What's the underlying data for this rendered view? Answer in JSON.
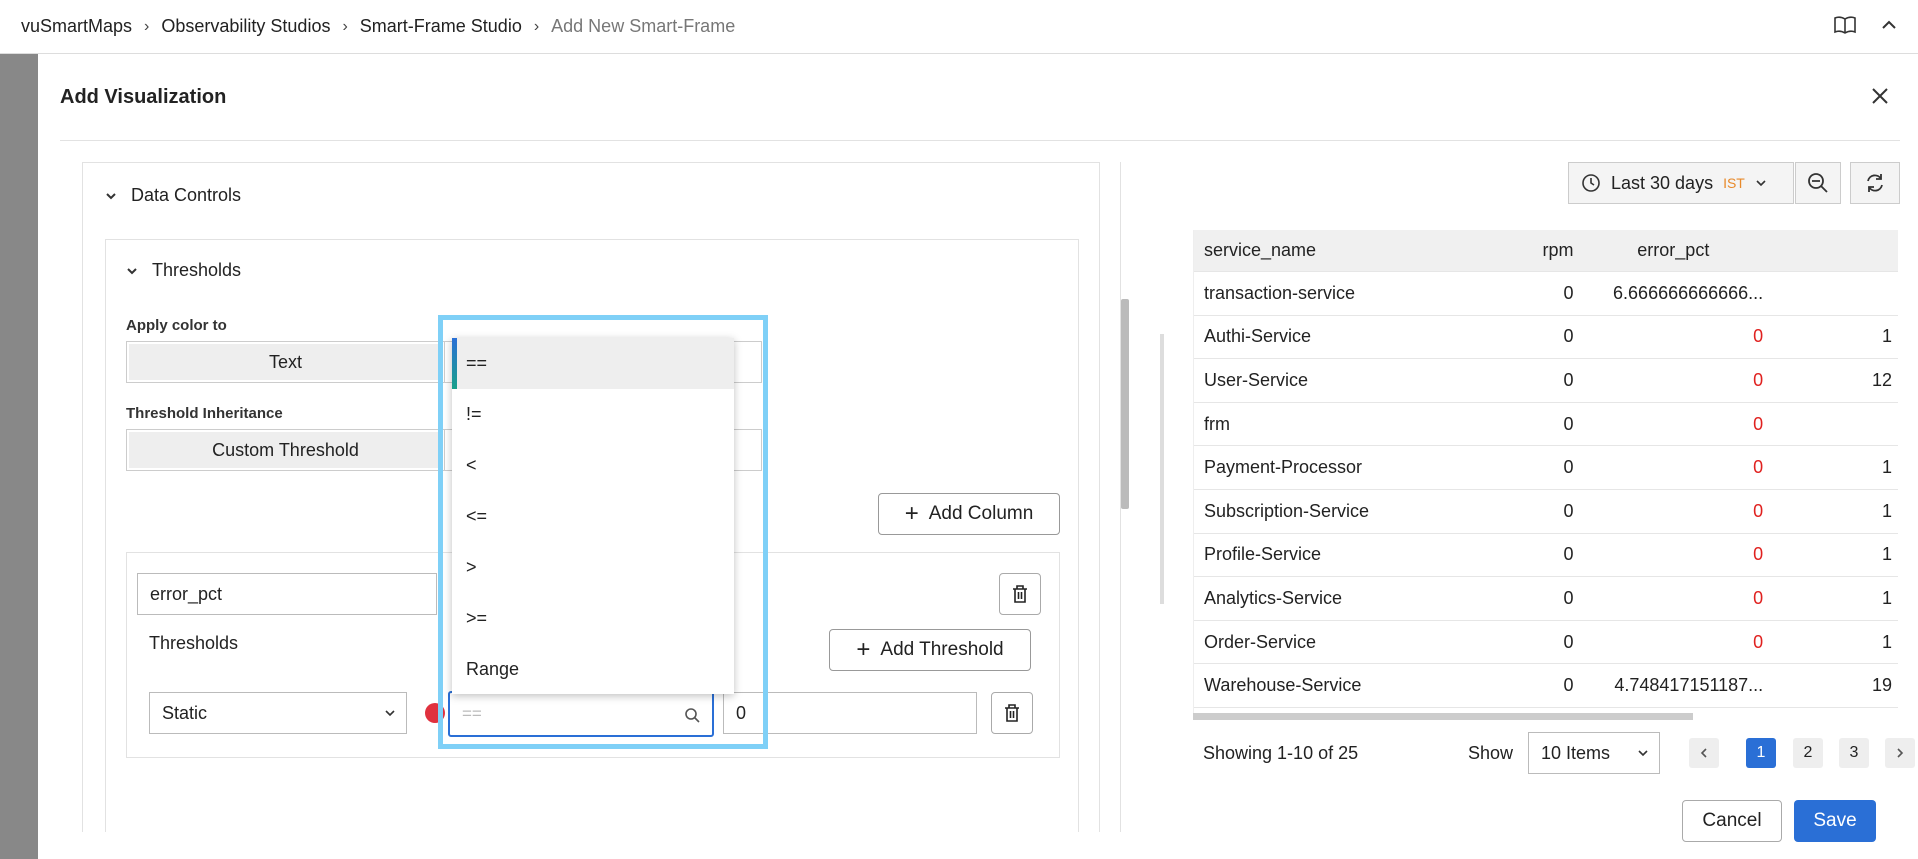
{
  "breadcrumb": [
    "vuSmartMaps",
    "Observability Studios",
    "Smart-Frame Studio",
    "Add New Smart-Frame"
  ],
  "modal": {
    "title": "Add Visualization",
    "data_controls": "Data Controls",
    "thresholds": "Thresholds",
    "apply_color_to_label": "Apply color to",
    "apply_color_selected": "Text",
    "threshold_inheritance_label": "Threshold Inheritance",
    "threshold_inheritance_selected": "Custom Threshold",
    "add_column": "Add Column",
    "column_value": "error_pct",
    "thresholds_sub": "Thresholds",
    "add_threshold": "Add Threshold",
    "threshold_type": "Static",
    "operator_placeholder": "==",
    "threshold_value": "0",
    "cancel": "Cancel",
    "save": "Save"
  },
  "operator_options": [
    "==",
    "!=",
    "<",
    "<=",
    ">",
    ">=",
    "Range"
  ],
  "time_range": {
    "label": "Last 30 days",
    "tz": "IST"
  },
  "table": {
    "headers": [
      "service_name",
      "rpm",
      "error_pct",
      ""
    ],
    "rows": [
      [
        "transaction-service",
        "0",
        "6.666666666666...",
        ""
      ],
      [
        "Authi-Service",
        "0",
        "0",
        "1"
      ],
      [
        "User-Service",
        "0",
        "0",
        "12"
      ],
      [
        "frm",
        "0",
        "0",
        ""
      ],
      [
        "Payment-Processor",
        "0",
        "0",
        "1"
      ],
      [
        "Subscription-Service",
        "0",
        "0",
        "1"
      ],
      [
        "Profile-Service",
        "0",
        "0",
        "1"
      ],
      [
        "Analytics-Service",
        "0",
        "0",
        "1"
      ],
      [
        "Order-Service",
        "0",
        "0",
        "1"
      ],
      [
        "Warehouse-Service",
        "0",
        "4.748417151187...",
        "19"
      ]
    ],
    "showing": "Showing 1-10 of 25",
    "show_label": "Show",
    "page_size": "10 Items",
    "pages": [
      "1",
      "2",
      "3"
    ]
  },
  "colors": {
    "accent": "#2a6fd6",
    "danger": "#e0313e",
    "highlight": "#7fd0f7"
  }
}
